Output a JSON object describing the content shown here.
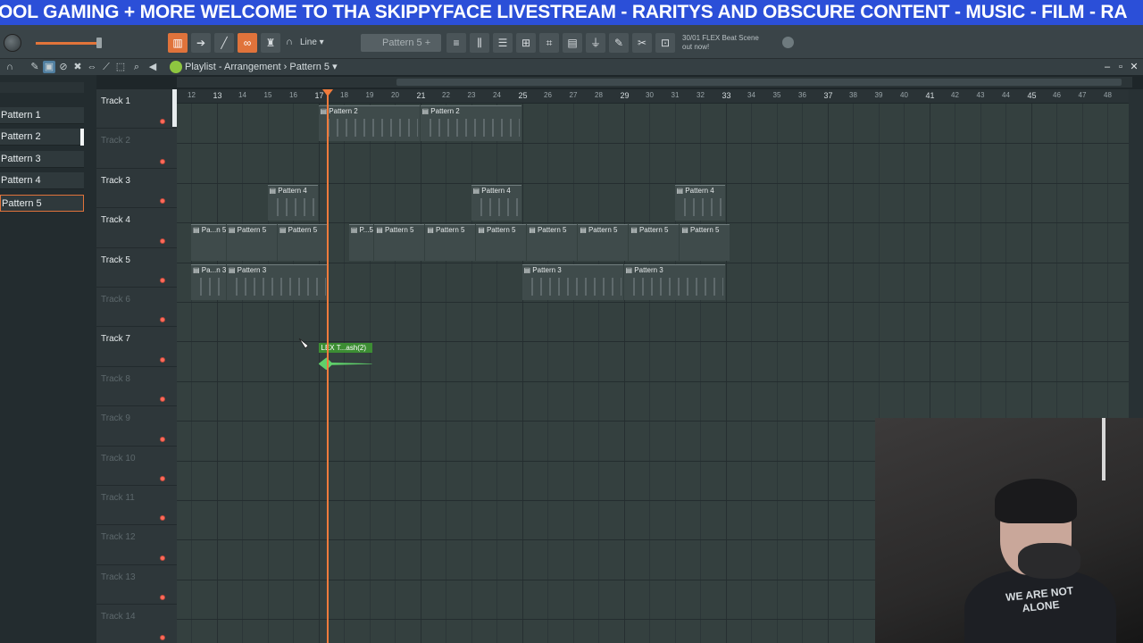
{
  "ticker": {
    "text": "OOL GAMING + MORE  WELCOME TO THA SKIPPYFACE LIVESTREAM  - RARITYS AND OBSCURE CONTENT - MUSIC - FILM - RA"
  },
  "toolbar": {
    "snap_label": "Line",
    "pattern_selector": "Pattern 5",
    "news_line1": "30/01 FLEX Beat Scene",
    "news_line2": "out now!",
    "icons": [
      "step-icon",
      "arrow-icon",
      "graph-icon",
      "link-icon",
      "stamp-icon",
      "magnet-icon",
      "mixer-icon",
      "piano-icon",
      "channel-icon",
      "browser-icon",
      "plugin-icon",
      "disk-icon",
      "wand-icon",
      "cart-icon",
      "globe-icon"
    ],
    "accent": "#e0733b"
  },
  "playlist": {
    "title": "Playlist - Arrangement",
    "pattern": "Pattern 5",
    "separator": "›",
    "win_min": "–",
    "win_max": "▫",
    "win_close": "✕"
  },
  "picker": {
    "items": [
      "Pattern 1",
      "Pattern 2",
      "Pattern 3",
      "Pattern 4",
      "Pattern 5"
    ],
    "selected": "Pattern 5"
  },
  "tracks": [
    "Track 1",
    "Track 2",
    "Track 3",
    "Track 4",
    "Track 5",
    "Track 6",
    "Track 7",
    "Track 8",
    "Track 9",
    "Track 10",
    "Track 11",
    "Track 12",
    "Track 13",
    "Track 14"
  ],
  "ruler": {
    "labels": [
      "12",
      "13",
      "14",
      "15",
      "16",
      "17",
      "18",
      "19",
      "20",
      "21",
      "22",
      "23",
      "24",
      "25",
      "26",
      "27",
      "28",
      "29",
      "30",
      "31",
      "32",
      "33",
      "34",
      "35",
      "36",
      "37",
      "38",
      "39",
      "40",
      "41",
      "42",
      "43",
      "44",
      "45",
      "46",
      "47",
      "48"
    ],
    "playhead_bar": "17"
  },
  "clips": {
    "track1": [
      "Pattern 2",
      "Pattern 2"
    ],
    "track3": [
      "Pattern 4",
      "Pattern 4",
      "Pattern 4"
    ],
    "track4": [
      "Pa...n 5",
      "Pattern 5",
      "Pattern 5",
      "P...5",
      "Pattern 5",
      "Pattern 5",
      "Pattern 5",
      "Pattern 5",
      "Pattern 5",
      "Pattern 5",
      "Pattern 5"
    ],
    "track5": [
      "Pa...n 3",
      "Pattern 3",
      "Pattern 3",
      "Pattern 3"
    ],
    "audio": "LEX T...ash(2)"
  },
  "webcam": {
    "shirt_text": "WE ARE NOT ALONE"
  }
}
